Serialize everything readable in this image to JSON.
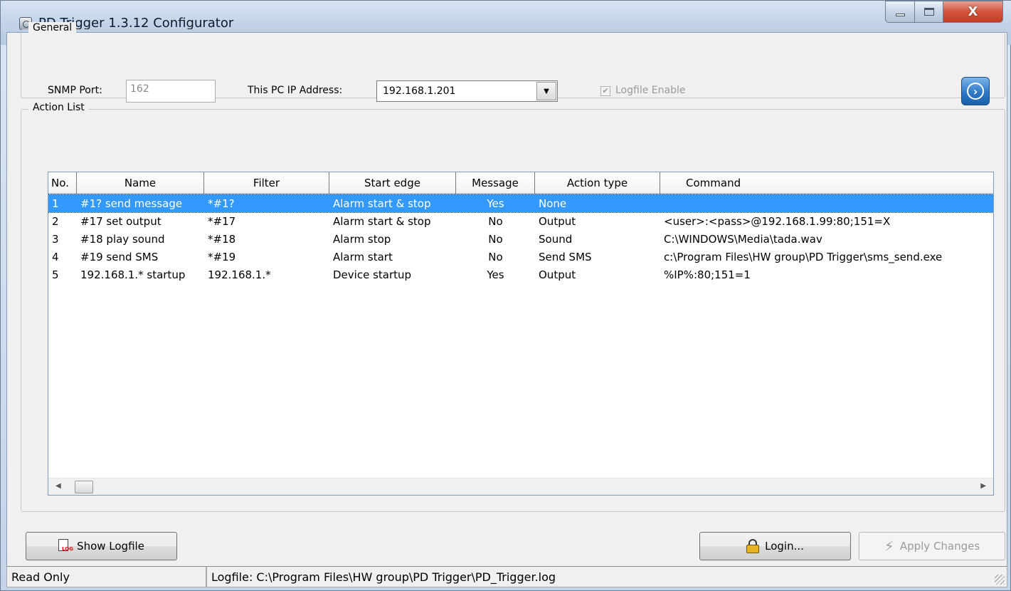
{
  "window": {
    "title": "PD Trigger 1.3.12 Configurator",
    "controls": {
      "close_symbol": "X"
    }
  },
  "general": {
    "legend": "General",
    "snmp_port_label": "SNMP Port:",
    "snmp_port_value": "162",
    "ip_label": "This PC IP Address:",
    "ip_value": "192.168.1.201",
    "logfile_enable_label": "Logfile Enable",
    "logfile_enable_checked": true
  },
  "action_list": {
    "legend": "Action List",
    "columns": [
      "No.",
      "Name",
      "Filter",
      "Start edge",
      "Message",
      "Action type",
      "Command"
    ],
    "rows": [
      {
        "no": "1",
        "name": "#1? send message",
        "filter": "*#1?",
        "start_edge": "Alarm start & stop",
        "message": "Yes",
        "action_type": "None",
        "command": ""
      },
      {
        "no": "2",
        "name": "#17 set output",
        "filter": "*#17",
        "start_edge": "Alarm start & stop",
        "message": "No",
        "action_type": "Output",
        "command": "<user>:<pass>@192.168.1.99:80;151=X"
      },
      {
        "no": "3",
        "name": "#18 play sound",
        "filter": "*#18",
        "start_edge": "Alarm stop",
        "message": "No",
        "action_type": "Sound",
        "command": "C:\\WINDOWS\\Media\\tada.wav"
      },
      {
        "no": "4",
        "name": "#19 send SMS",
        "filter": "*#19",
        "start_edge": "Alarm start",
        "message": "No",
        "action_type": "Send SMS",
        "command": "c:\\Program Files\\HW group\\PD Trigger\\sms_send.exe"
      },
      {
        "no": "5",
        "name": "192.168.1.* startup",
        "filter": "192.168.1.*",
        "start_edge": "Device startup",
        "message": "Yes",
        "action_type": "Output",
        "command": "%IP%:80;151=1"
      }
    ],
    "selected_row": 1
  },
  "buttons": {
    "show_logfile": "Show Logfile",
    "login": "Login...",
    "apply_changes": "Apply Changes"
  },
  "statusbar": {
    "mode": "Read Only",
    "logfile": "Logfile: C:\\Program Files\\HW group\\PD Trigger\\PD_Trigger.log"
  },
  "colors": {
    "selection": "#3399ff",
    "go_button": "#2d79c8",
    "close_button": "#c23b22"
  },
  "icons": [
    "app-icon",
    "minimize-icon",
    "maximize-icon",
    "close-icon",
    "dropdown-arrow-icon",
    "go-arrow-icon",
    "logfile-icon",
    "lock-icon",
    "apply-icon",
    "scroll-left-icon",
    "scroll-right-icon",
    "size-grip-icon"
  ]
}
